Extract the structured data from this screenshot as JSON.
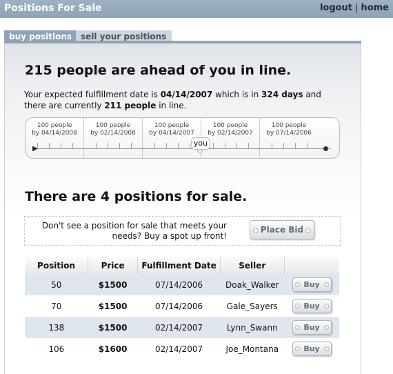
{
  "header": {
    "title": "Positions For Sale",
    "links": [
      "logout",
      "home"
    ],
    "separator": "|"
  },
  "tabs": [
    {
      "label": "buy positions",
      "active": true
    },
    {
      "label": "sell your positions",
      "active": false
    }
  ],
  "queue": {
    "headline": "215 people are ahead of you in line.",
    "text_prefix": "Your expected fulfillment date is ",
    "fulfillment_date": "04/14/2007",
    "text_mid": " which is in ",
    "days": "324 days",
    "text_mid2": " and there are currently ",
    "people_count": "211 people",
    "text_suffix": " in line."
  },
  "timeline": {
    "segments": [
      {
        "line1": "100 people",
        "line2": "by 04/14/2008"
      },
      {
        "line1": "100 people",
        "line2": "by 02/14/2008"
      },
      {
        "line1": "100 people",
        "line2": "by 04/14/2007"
      },
      {
        "line1": "100 people",
        "line2": "by 02/14/2007"
      },
      {
        "line1": "100 people",
        "line2": "by 07/14/2006"
      }
    ],
    "marker_label": "you"
  },
  "sale": {
    "heading": "There are 4 positions for sale.",
    "bid_prompt_line1": "Don't see a position for sale that meets your",
    "bid_prompt_line2": "needs? Buy a spot up front!",
    "place_bid_label": "Place Bid"
  },
  "table": {
    "columns": [
      "Position",
      "Price",
      "Fulfillment Date",
      "Seller",
      ""
    ],
    "rows": [
      {
        "position": "50",
        "price": "$1500",
        "date": "07/14/2006",
        "seller": "Doak_Walker",
        "action": "Buy"
      },
      {
        "position": "70",
        "price": "$1500",
        "date": "07/14/2006",
        "seller": "Gale_Sayers",
        "action": "Buy"
      },
      {
        "position": "138",
        "price": "$1500",
        "date": "02/14/2007",
        "seller": "Lynn_Swann",
        "action": "Buy"
      },
      {
        "position": "106",
        "price": "$1600",
        "date": "02/14/2007",
        "seller": "Joe_Montana",
        "action": "Buy"
      }
    ]
  },
  "colors": {
    "header_bar": "#8fa3b7",
    "row_alt": "#dfe6ee"
  }
}
